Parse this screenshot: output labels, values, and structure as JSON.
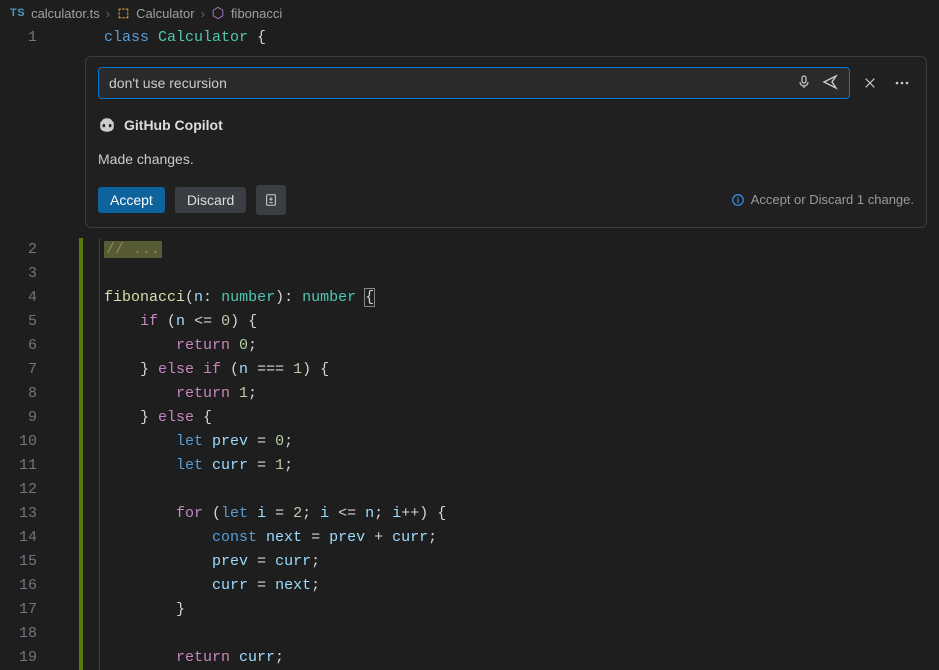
{
  "breadcrumbs": {
    "file_badge": "TS",
    "file": "calculator.ts",
    "class": "Calculator",
    "symbol": "fibonacci"
  },
  "chat": {
    "input_value": "don't use recursion",
    "provider": "GitHub Copilot",
    "status": "Made changes.",
    "accept_label": "Accept",
    "discard_label": "Discard",
    "hint": "Accept or Discard 1 change."
  },
  "code": {
    "lines": [
      {
        "n": "1",
        "added": false,
        "guide": false,
        "tokens": [
          [
            "kw",
            "class "
          ],
          [
            "cls",
            "Calculator "
          ],
          [
            "pn",
            "{"
          ]
        ]
      },
      {
        "n": "2",
        "added": true,
        "guide": true,
        "tokens": [
          [
            "hlcmt",
            "// ..."
          ]
        ]
      },
      {
        "n": "3",
        "added": true,
        "guide": true,
        "tokens": []
      },
      {
        "n": "4",
        "added": true,
        "guide": true,
        "tokens": [
          [
            "fn",
            "fibonacci"
          ],
          [
            "pn",
            "("
          ],
          [
            "var",
            "n"
          ],
          [
            "pn",
            ": "
          ],
          [
            "cls",
            "number"
          ],
          [
            "pn",
            "): "
          ],
          [
            "cls",
            "number "
          ],
          [
            "pn-bracket",
            "{"
          ]
        ]
      },
      {
        "n": "5",
        "added": true,
        "guide": true,
        "tokens": [
          [
            "pn",
            "    "
          ],
          [
            "ctl",
            "if "
          ],
          [
            "pn",
            "("
          ],
          [
            "var",
            "n "
          ],
          [
            "pn",
            "<= "
          ],
          [
            "num",
            "0"
          ],
          [
            "pn",
            ") {"
          ]
        ]
      },
      {
        "n": "6",
        "added": true,
        "guide": true,
        "tokens": [
          [
            "pn",
            "        "
          ],
          [
            "ctl",
            "return "
          ],
          [
            "num",
            "0"
          ],
          [
            "pn",
            ";"
          ]
        ]
      },
      {
        "n": "7",
        "added": true,
        "guide": true,
        "tokens": [
          [
            "pn",
            "    } "
          ],
          [
            "ctl",
            "else if "
          ],
          [
            "pn",
            "("
          ],
          [
            "var",
            "n "
          ],
          [
            "pn",
            "=== "
          ],
          [
            "num",
            "1"
          ],
          [
            "pn",
            ") {"
          ]
        ]
      },
      {
        "n": "8",
        "added": true,
        "guide": true,
        "tokens": [
          [
            "pn",
            "        "
          ],
          [
            "ctl",
            "return "
          ],
          [
            "num",
            "1"
          ],
          [
            "pn",
            ";"
          ]
        ]
      },
      {
        "n": "9",
        "added": true,
        "guide": true,
        "tokens": [
          [
            "pn",
            "    } "
          ],
          [
            "ctl",
            "else "
          ],
          [
            "pn",
            "{"
          ]
        ]
      },
      {
        "n": "10",
        "added": true,
        "guide": true,
        "tokens": [
          [
            "pn",
            "        "
          ],
          [
            "kw",
            "let "
          ],
          [
            "var",
            "prev "
          ],
          [
            "pn",
            "= "
          ],
          [
            "num",
            "0"
          ],
          [
            "pn",
            ";"
          ]
        ]
      },
      {
        "n": "11",
        "added": true,
        "guide": true,
        "tokens": [
          [
            "pn",
            "        "
          ],
          [
            "kw",
            "let "
          ],
          [
            "var",
            "curr "
          ],
          [
            "pn",
            "= "
          ],
          [
            "num",
            "1"
          ],
          [
            "pn",
            ";"
          ]
        ]
      },
      {
        "n": "12",
        "added": true,
        "guide": true,
        "tokens": []
      },
      {
        "n": "13",
        "added": true,
        "guide": true,
        "tokens": [
          [
            "pn",
            "        "
          ],
          [
            "ctl",
            "for "
          ],
          [
            "pn",
            "("
          ],
          [
            "kw",
            "let "
          ],
          [
            "var",
            "i "
          ],
          [
            "pn",
            "= "
          ],
          [
            "num",
            "2"
          ],
          [
            "pn",
            "; "
          ],
          [
            "var",
            "i "
          ],
          [
            "pn",
            "<= "
          ],
          [
            "var",
            "n"
          ],
          [
            "pn",
            "; "
          ],
          [
            "var",
            "i"
          ],
          [
            "pn",
            "++) {"
          ]
        ]
      },
      {
        "n": "14",
        "added": true,
        "guide": true,
        "tokens": [
          [
            "pn",
            "            "
          ],
          [
            "kw",
            "const "
          ],
          [
            "var",
            "next "
          ],
          [
            "pn",
            "= "
          ],
          [
            "var",
            "prev "
          ],
          [
            "pn",
            "+ "
          ],
          [
            "var",
            "curr"
          ],
          [
            "pn",
            ";"
          ]
        ]
      },
      {
        "n": "15",
        "added": true,
        "guide": true,
        "tokens": [
          [
            "pn",
            "            "
          ],
          [
            "var",
            "prev "
          ],
          [
            "pn",
            "= "
          ],
          [
            "var",
            "curr"
          ],
          [
            "pn",
            ";"
          ]
        ]
      },
      {
        "n": "16",
        "added": true,
        "guide": true,
        "tokens": [
          [
            "pn",
            "            "
          ],
          [
            "var",
            "curr "
          ],
          [
            "pn",
            "= "
          ],
          [
            "var",
            "next"
          ],
          [
            "pn",
            ";"
          ]
        ]
      },
      {
        "n": "17",
        "added": true,
        "guide": true,
        "tokens": [
          [
            "pn",
            "        }"
          ]
        ]
      },
      {
        "n": "18",
        "added": true,
        "guide": true,
        "tokens": []
      },
      {
        "n": "19",
        "added": true,
        "guide": true,
        "tokens": [
          [
            "pn",
            "        "
          ],
          [
            "ctl",
            "return "
          ],
          [
            "var",
            "curr"
          ],
          [
            "pn",
            ";"
          ]
        ]
      }
    ]
  }
}
